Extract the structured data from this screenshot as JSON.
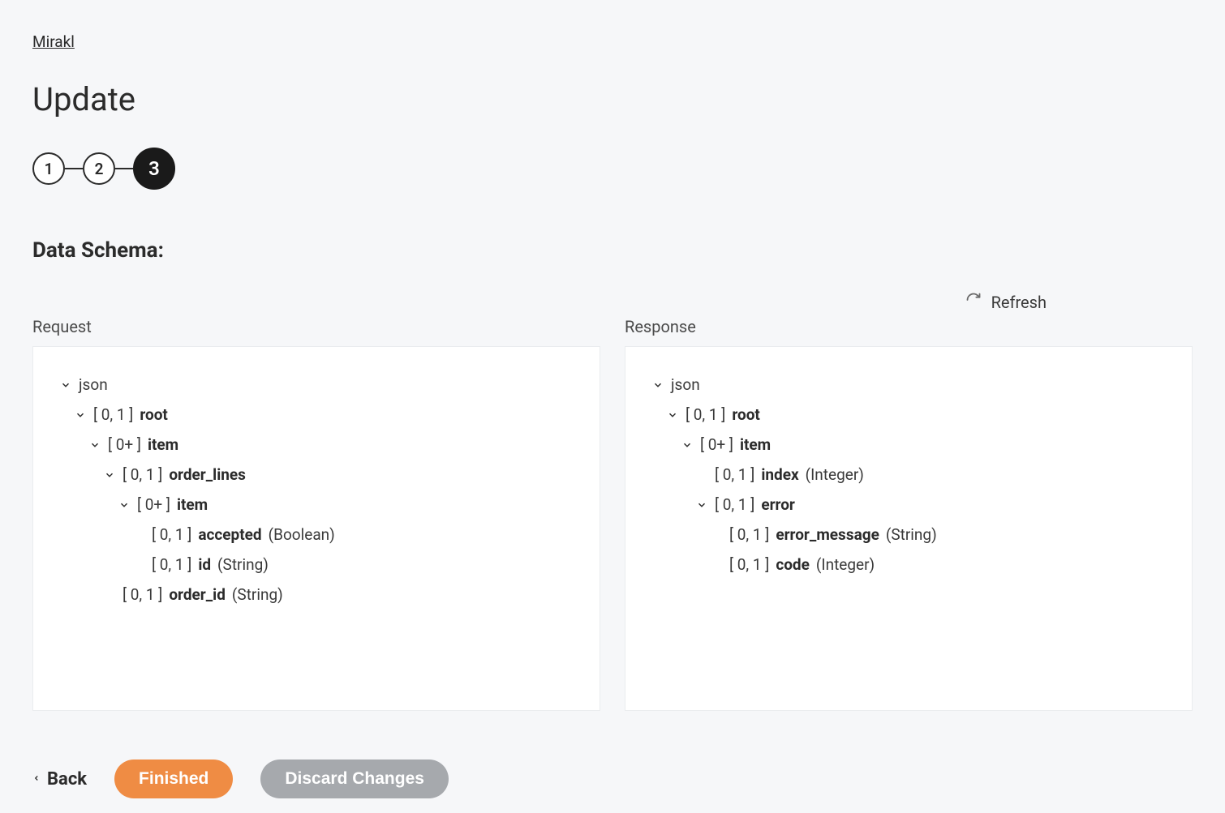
{
  "breadcrumb": "Mirakl",
  "page_title": "Update",
  "stepper": {
    "step1": "1",
    "step2": "2",
    "step3": "3"
  },
  "section_title": "Data Schema:",
  "refresh_label": "Refresh",
  "request": {
    "label": "Request",
    "root_label": "json",
    "n1": {
      "card": "[ 0, 1 ]",
      "name": "root"
    },
    "n2": {
      "card": "[ 0+ ]",
      "name": "item"
    },
    "n3": {
      "card": "[ 0, 1 ]",
      "name": "order_lines"
    },
    "n4": {
      "card": "[ 0+ ]",
      "name": "item"
    },
    "n5": {
      "card": "[ 0, 1 ]",
      "name": "accepted",
      "type": "(Boolean)"
    },
    "n6": {
      "card": "[ 0, 1 ]",
      "name": "id",
      "type": "(String)"
    },
    "n7": {
      "card": "[ 0, 1 ]",
      "name": "order_id",
      "type": "(String)"
    }
  },
  "response": {
    "label": "Response",
    "root_label": "json",
    "n1": {
      "card": "[ 0, 1 ]",
      "name": "root"
    },
    "n2": {
      "card": "[ 0+ ]",
      "name": "item"
    },
    "n3": {
      "card": "[ 0, 1 ]",
      "name": "index",
      "type": "(Integer)"
    },
    "n4": {
      "card": "[ 0, 1 ]",
      "name": "error"
    },
    "n5": {
      "card": "[ 0, 1 ]",
      "name": "error_message",
      "type": "(String)"
    },
    "n6": {
      "card": "[ 0, 1 ]",
      "name": "code",
      "type": "(Integer)"
    }
  },
  "buttons": {
    "back": "Back",
    "finished": "Finished",
    "discard": "Discard Changes"
  }
}
